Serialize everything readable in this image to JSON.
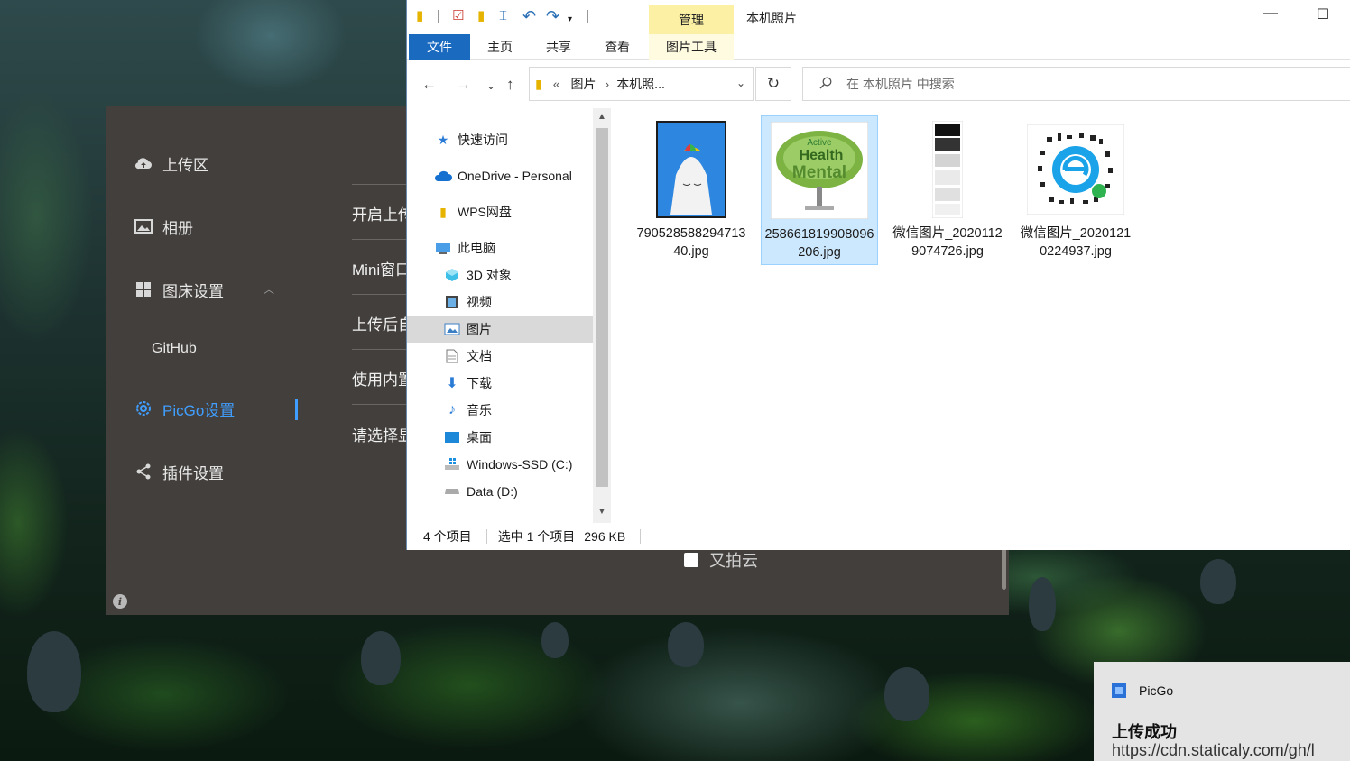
{
  "picgo": {
    "sidebar": [
      {
        "label": "上传区",
        "icon": "cloud-upload-icon"
      },
      {
        "label": "相册",
        "icon": "image-icon"
      },
      {
        "label": "图床设置",
        "icon": "grid-icon"
      },
      {
        "label": "GitHub",
        "icon": ""
      },
      {
        "label": "PicGo设置",
        "icon": "gear-icon"
      },
      {
        "label": "插件设置",
        "icon": "share-icon"
      }
    ],
    "settings_rows": [
      "开启上传提示",
      "Mini窗口",
      "上传后自动复制URL",
      "使用内置剪贴板上传",
      "请选择显示的图床"
    ],
    "checkbox_label": "又拍云",
    "accent_color": "#409eff"
  },
  "explorer": {
    "window_title": "本机照片",
    "manage_tab": "管理",
    "ribbon_tabs": [
      "文件",
      "主页",
      "共享",
      "查看",
      "图片工具"
    ],
    "address": {
      "chevron": "«",
      "crumbs": [
        "图片",
        "本机照..."
      ]
    },
    "search_placeholder": "在 本机照片 中搜索",
    "nav_items": [
      {
        "label": "快速访问",
        "icon": "star-icon"
      },
      {
        "label": "OneDrive - Personal",
        "icon": "cloud-icon"
      },
      {
        "label": "WPS网盘",
        "icon": "folder-icon"
      },
      {
        "label": "此电脑",
        "icon": "computer-icon"
      },
      {
        "label": "3D 对象",
        "icon": "cube-icon"
      },
      {
        "label": "视频",
        "icon": "film-icon"
      },
      {
        "label": "图片",
        "icon": "picture-icon"
      },
      {
        "label": "文档",
        "icon": "document-icon"
      },
      {
        "label": "下载",
        "icon": "download-icon"
      },
      {
        "label": "音乐",
        "icon": "music-icon"
      },
      {
        "label": "桌面",
        "icon": "desktop-icon"
      },
      {
        "label": "Windows-SSD (C:)",
        "icon": "drive-c-icon"
      },
      {
        "label": "Data (D:)",
        "icon": "drive-d-icon"
      }
    ],
    "files": [
      {
        "name": "79052858829471340.jpg",
        "selected": false,
        "thumb_text": ""
      },
      {
        "name": "258661819908096206.jpg",
        "selected": true,
        "thumb_text": "Active Health Mental"
      },
      {
        "name": "微信图片_20201129074726.jpg",
        "selected": false,
        "thumb_text": ""
      },
      {
        "name": "微信图片_20201210224937.jpg",
        "selected": false,
        "thumb_text": ""
      }
    ],
    "status": {
      "count": "4 个项目",
      "selection": "选中 1 个项目",
      "size": "296 KB"
    }
  },
  "toast": {
    "app_name": "PicGo",
    "title": "上传成功",
    "body": "https://cdn.staticaly.com/gh/l"
  }
}
